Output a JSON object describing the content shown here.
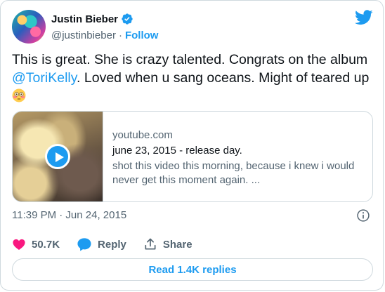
{
  "author": {
    "display_name": "Justin Bieber",
    "handle": "@justinbieber",
    "separator": "·",
    "follow_label": "Follow"
  },
  "tweet": {
    "text_before": "This is great. She is crazy talented. Congrats on the album ",
    "mention": "@ToriKelly",
    "text_after": ". Loved when u sang oceans. Might of teared up",
    "emoji": "flushed-face"
  },
  "link_card": {
    "domain": "youtube.com",
    "title": "june 23, 2015 - release day.",
    "description": "shot this video this morning, because i knew i would never get this moment again. ..."
  },
  "timestamp": "11:39 PM · Jun 24, 2015",
  "actions": {
    "likes": "50.7K",
    "reply_label": "Reply",
    "share_label": "Share"
  },
  "read_replies_label": "Read 1.4K replies",
  "colors": {
    "accent": "#1d9bf0",
    "like": "#f91880",
    "text": "#0f1419",
    "secondary": "#536471",
    "border": "#cfd9de"
  }
}
